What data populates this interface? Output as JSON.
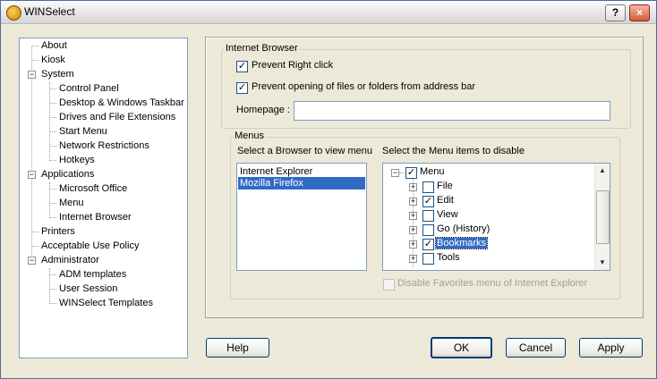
{
  "window": {
    "title": "WINSelect",
    "help_btn": "?",
    "close_btn": "×"
  },
  "nav_tree": [
    {
      "label": "About",
      "level": 0
    },
    {
      "label": "Kiosk",
      "level": 0
    },
    {
      "label": "System",
      "level": 0,
      "expanded": true
    },
    {
      "label": "Control Panel",
      "level": 1
    },
    {
      "label": "Desktop & Windows Taskbar",
      "level": 1
    },
    {
      "label": "Drives and File Extensions",
      "level": 1
    },
    {
      "label": "Start Menu",
      "level": 1
    },
    {
      "label": "Network Restrictions",
      "level": 1
    },
    {
      "label": "Hotkeys",
      "level": 1
    },
    {
      "label": "Applications",
      "level": 0,
      "expanded": true
    },
    {
      "label": "Microsoft Office",
      "level": 1
    },
    {
      "label": "Menu",
      "level": 1
    },
    {
      "label": "Internet Browser",
      "level": 1,
      "selected": true
    },
    {
      "label": "Printers",
      "level": 0
    },
    {
      "label": "Acceptable Use Policy",
      "level": 0
    },
    {
      "label": "Administrator",
      "level": 0,
      "expanded": true
    },
    {
      "label": "ADM templates",
      "level": 1
    },
    {
      "label": "User Session",
      "level": 1
    },
    {
      "label": "WINSelect Templates",
      "level": 1
    }
  ],
  "internet_browser": {
    "group_title": "Internet Browser",
    "prevent_right_click": {
      "label": "Prevent Right click",
      "checked": true
    },
    "prevent_opening": {
      "label": "Prevent opening of files or folders from address bar",
      "checked": true
    },
    "homepage_label": "Homepage :",
    "homepage_value": ""
  },
  "menus": {
    "group_title": "Menus",
    "browser_list_label": "Select a Browser to view menu",
    "browsers": [
      {
        "label": "Internet Explorer",
        "selected": false
      },
      {
        "label": "Mozilla Firefox",
        "selected": true
      }
    ],
    "items_label": "Select the Menu items to disable",
    "menu_root": {
      "label": "Menu",
      "checked": true
    },
    "menu_items": [
      {
        "label": "File",
        "checked": false
      },
      {
        "label": "Edit",
        "checked": true
      },
      {
        "label": "View",
        "checked": false
      },
      {
        "label": "Go (History)",
        "checked": false
      },
      {
        "label": "Bookmarks",
        "checked": true,
        "selected": true
      },
      {
        "label": "Tools",
        "checked": false
      }
    ],
    "disable_favorites": {
      "label": "Disable Favorites menu of Internet Explorer",
      "checked": false,
      "enabled": false
    }
  },
  "buttons": {
    "help": "Help",
    "ok": "OK",
    "cancel": "Cancel",
    "apply": "Apply"
  }
}
